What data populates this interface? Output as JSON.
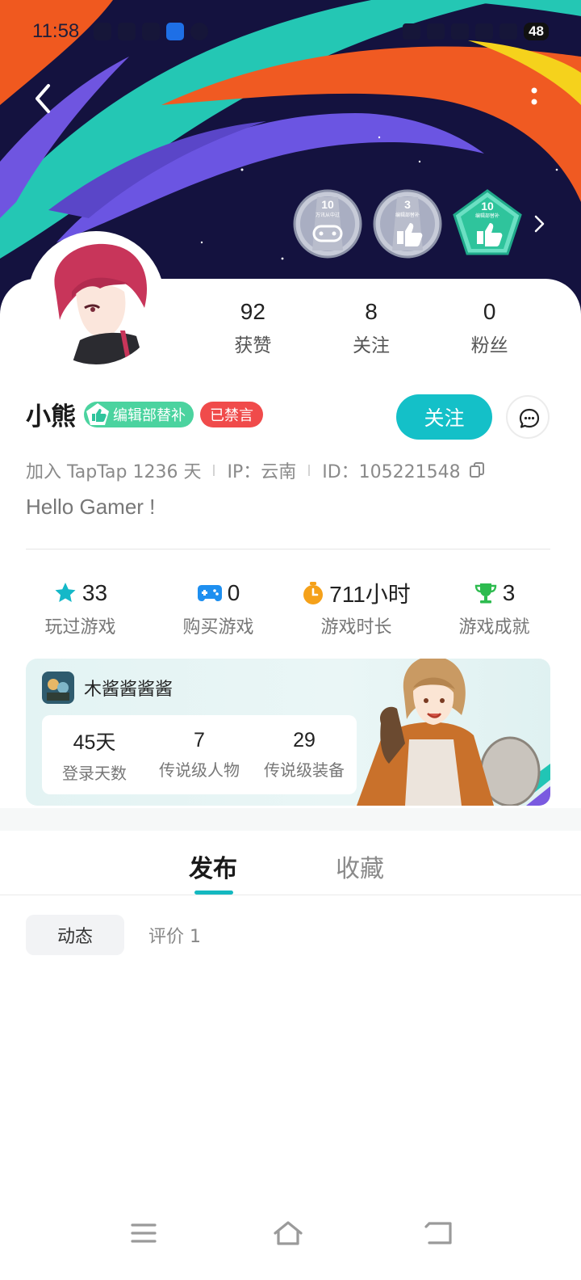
{
  "status_bar": {
    "time": "11:58",
    "battery": "48"
  },
  "badges": [
    {
      "number": "10",
      "caption": "万讯从中过"
    },
    {
      "number": "3",
      "caption": "编辑部替补"
    },
    {
      "number": "10",
      "caption": "编辑部替补"
    }
  ],
  "profile": {
    "stats": [
      {
        "value": "92",
        "label": "获赞"
      },
      {
        "value": "8",
        "label": "关注"
      },
      {
        "value": "0",
        "label": "粉丝"
      }
    ],
    "name": "小熊",
    "tag_editor": "编辑部替补",
    "tag_banned": "已禁言",
    "follow_label": "关注",
    "joined": "加入 TapTap 1236 天",
    "ip": "IP：云南",
    "user_id": "ID：105221548",
    "bio": "Hello Gamer !"
  },
  "game_stats": [
    {
      "icon": "star-icon",
      "value": "33",
      "label": "玩过游戏"
    },
    {
      "icon": "gamepad-icon",
      "value": "0",
      "label": "购买游戏"
    },
    {
      "icon": "timer-icon",
      "value": "711小时",
      "label": "游戏时长"
    },
    {
      "icon": "trophy-icon",
      "value": "3",
      "label": "游戏成就"
    }
  ],
  "game_card": {
    "name": "木酱酱酱酱",
    "stats": [
      {
        "value": "45天",
        "label": "登录天数"
      },
      {
        "value": "7",
        "label": "传说级人物"
      },
      {
        "value": "29",
        "label": "传说级装备"
      }
    ]
  },
  "tabs": [
    {
      "label": "发布"
    },
    {
      "label": "收藏"
    }
  ],
  "subtabs": [
    {
      "label": "动态"
    },
    {
      "label": "评价 1"
    }
  ],
  "colors": {
    "accent": "#14c0c8",
    "banned": "#f04b4b",
    "editor": "#4bd39f",
    "banner_bg": "#14123f"
  }
}
